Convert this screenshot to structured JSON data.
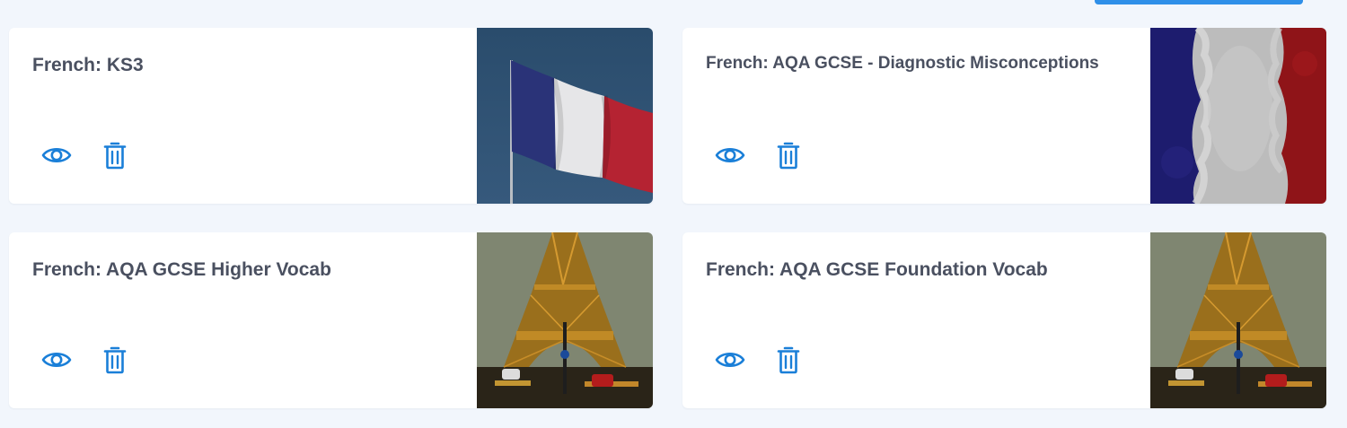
{
  "colors": {
    "background": "#f2f6fc",
    "card": "#ffffff",
    "title_text": "#4a5060",
    "icon_accent": "#1a7fd8",
    "top_button": "#2f8fe8"
  },
  "cards": [
    {
      "title": "French: KS3",
      "image": "french-flag-pole",
      "actions": [
        {
          "icon": "eye-icon",
          "purpose": "view"
        },
        {
          "icon": "trash-icon",
          "purpose": "delete"
        }
      ]
    },
    {
      "title": "French: AQA GCSE - Diagnostic Misconceptions",
      "image": "french-flag-painted",
      "actions": [
        {
          "icon": "eye-icon",
          "purpose": "view"
        },
        {
          "icon": "trash-icon",
          "purpose": "delete"
        }
      ]
    },
    {
      "title": "French: AQA GCSE Higher Vocab",
      "image": "eiffel-tower-night",
      "actions": [
        {
          "icon": "eye-icon",
          "purpose": "view"
        },
        {
          "icon": "trash-icon",
          "purpose": "delete"
        }
      ]
    },
    {
      "title": "French: AQA GCSE Foundation Vocab",
      "image": "eiffel-tower-night",
      "actions": [
        {
          "icon": "eye-icon",
          "purpose": "view"
        },
        {
          "icon": "trash-icon",
          "purpose": "delete"
        }
      ]
    }
  ]
}
